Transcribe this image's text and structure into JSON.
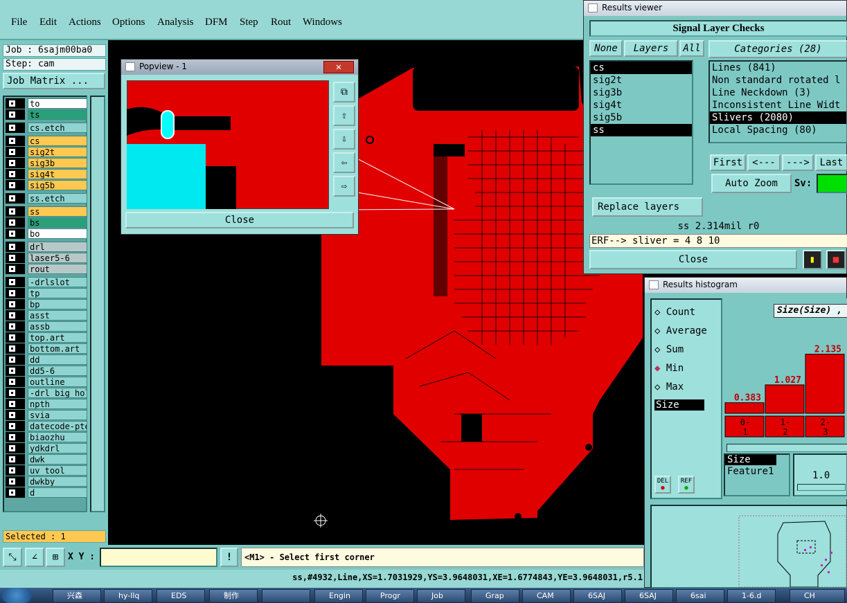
{
  "menu": [
    "File",
    "Edit",
    "Actions",
    "Options",
    "Analysis",
    "DFM",
    "Step",
    "Rout",
    "Windows"
  ],
  "job": {
    "job_label": "Job : 6sajm00ba0",
    "step_label": "Step: cam",
    "matrix_button": "Job Matrix ..."
  },
  "layers": [
    {
      "name": "to",
      "color": "w"
    },
    {
      "name": "ts",
      "color": "g"
    },
    {
      "name": "cs.etch",
      "color": "t",
      "gap": true
    },
    {
      "name": "cs",
      "color": "o",
      "gap": true
    },
    {
      "name": "sig2t",
      "color": "o"
    },
    {
      "name": "sig3b",
      "color": "o"
    },
    {
      "name": "sig4t",
      "color": "o"
    },
    {
      "name": "sig5b",
      "color": "o"
    },
    {
      "name": "ss.etch",
      "color": "t",
      "gap": true
    },
    {
      "name": "ss",
      "color": "o",
      "gap": true
    },
    {
      "name": "bs",
      "color": "g"
    },
    {
      "name": "bo",
      "color": "w"
    },
    {
      "name": "drl",
      "color": "x",
      "gap": true
    },
    {
      "name": "laser5-6",
      "color": "x"
    },
    {
      "name": "rout",
      "color": "x"
    },
    {
      "name": "-drlslot",
      "color": "t",
      "gap": true
    },
    {
      "name": "tp",
      "color": "t"
    },
    {
      "name": "bp",
      "color": "t"
    },
    {
      "name": "asst",
      "color": "t"
    },
    {
      "name": "assb",
      "color": "t"
    },
    {
      "name": "top.art",
      "color": "t"
    },
    {
      "name": "bottom.art",
      "color": "t"
    },
    {
      "name": "dd",
      "color": "t"
    },
    {
      "name": "dd5-6",
      "color": "t"
    },
    {
      "name": "outline",
      "color": "t"
    },
    {
      "name": "-drl_big_hol",
      "color": "t"
    },
    {
      "name": "npth",
      "color": "t"
    },
    {
      "name": "svia",
      "color": "t"
    },
    {
      "name": "datecode-pte",
      "color": "t"
    },
    {
      "name": "biaozhu",
      "color": "t"
    },
    {
      "name": "ydkdrl",
      "color": "t"
    },
    {
      "name": "dwk",
      "color": "t"
    },
    {
      "name": "uv_tool",
      "color": "t"
    },
    {
      "name": "dwkby",
      "color": "t"
    },
    {
      "name": "d",
      "color": "t"
    }
  ],
  "selected": "Selected : 1",
  "status": {
    "xy_label": "X Y :",
    "prompt": "<M1> - Select first corner",
    "coords": "ss,#4932,Line,XS=1.7031929,YS=3.9648031,XE=1.6774843,YE=3.9648031,r5.1"
  },
  "popview": {
    "title": "Popview - 1",
    "close": "Close"
  },
  "results": {
    "title": "Results viewer",
    "header": "Signal Layer Checks",
    "none": "None",
    "layers_tab": "Layers",
    "all": "All",
    "categories": "Categories (28)",
    "layer_list": [
      "cs",
      "sig2t",
      "sig3b",
      "sig4t",
      "sig5b",
      "ss"
    ],
    "category_list": [
      "Lines (841)",
      "Non standard rotated l",
      "Line Neckdown (3)",
      "Inconsistent Line Widt",
      "Slivers (2080)",
      "Local Spacing (80)"
    ],
    "nav": [
      "First",
      "<---",
      "--->",
      "Last"
    ],
    "auto_zoom": "Auto Zoom",
    "sv": "Sv:",
    "replace": "Replace layers",
    "measure": "ss 2.314mil  r0",
    "erf": "ERF--> sliver = 4 8 10",
    "close": "Close"
  },
  "histogram": {
    "title": "Results histogram",
    "modes": [
      "Count",
      "Average",
      "Sum",
      "Min",
      "Max"
    ],
    "selected_mode": "Min",
    "field": "Size",
    "field_list": [
      "Size",
      "Feature1"
    ],
    "chart_title": "Size(Size) ,",
    "bars": [
      {
        "label": "0.383",
        "bin": "0-\n1",
        "value": 0.383
      },
      {
        "label": "1.027",
        "bin": "1-\n2",
        "value": 1.027
      },
      {
        "label": "2.135",
        "bin": "2-\n3",
        "value": 2.135
      }
    ],
    "del": "DEL",
    "ref": "REF",
    "scale": "1.0"
  },
  "taskbar": [
    "兴森",
    "hy-llq",
    "EDS",
    "制作",
    "",
    "Engin",
    "Progr",
    "Job",
    "Grap",
    "CAM",
    "6SAJ",
    "6SAJ",
    "6sai",
    "1-6.d",
    "CH"
  ]
}
